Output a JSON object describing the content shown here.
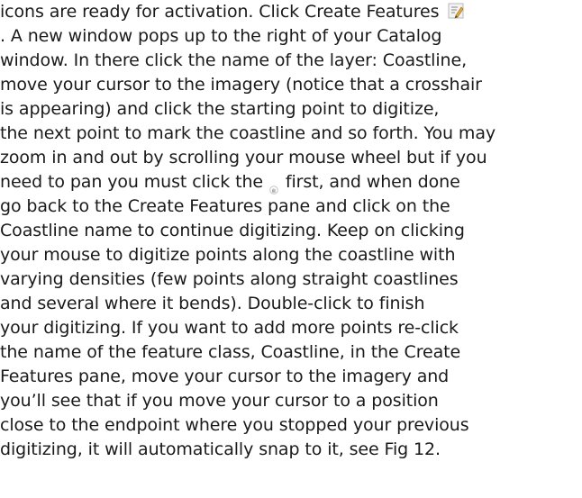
{
  "document": {
    "lines": [
      "icons are ready for activation. Click Create Features",
      ". A new window pops up to the right of your Catalog",
      "window. In there click the name of the layer: Coastline,",
      "move your cursor to the imagery (notice that a crosshair",
      "is appearing) and click the starting point to digitize,",
      "the next point to mark the coastline and so forth. You may",
      "zoom in and out by scrolling your mouse wheel but if you",
      "need to pan you must click the",
      "first, and when done",
      "go back to the Create Features pane and click on the",
      "Coastline name to continue digitizing. Keep on clicking",
      "your mouse to digitize points along the coastline with",
      "varying densities (few points along straight coastlines",
      "and several where it bends). Double-click to finish",
      "your digitizing. If you want to add more points re-click",
      "the name of the feature class, Coastline, in the Create",
      "Features pane, move your cursor to the imagery and",
      "you’ll see that if you move your cursor to a position",
      "close to the endpoint where you stopped your previous",
      "digitizing, it will automatically snap to it, see Fig 12."
    ],
    "icons": {
      "create_features": "create-features-icon",
      "pan": "pan-hand-icon"
    }
  }
}
